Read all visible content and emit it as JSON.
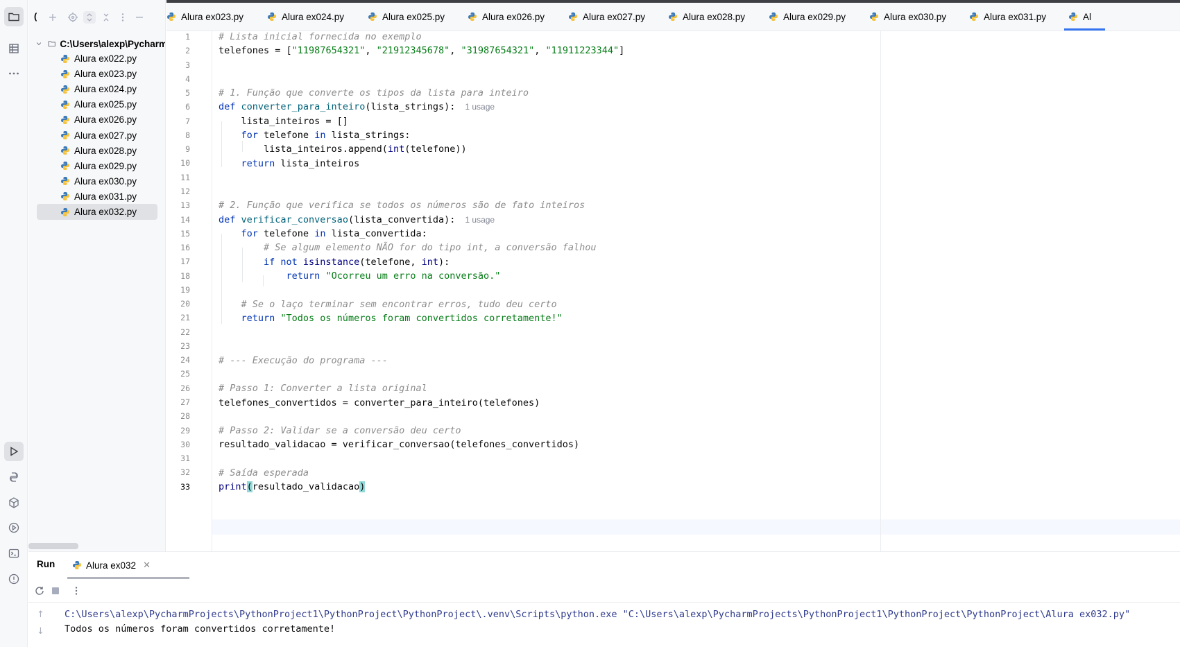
{
  "tabs": [
    {
      "label": "Alura ex023.py"
    },
    {
      "label": "Alura ex024.py"
    },
    {
      "label": "Alura ex025.py"
    },
    {
      "label": "Alura ex026.py"
    },
    {
      "label": "Alura ex027.py"
    },
    {
      "label": "Alura ex028.py"
    },
    {
      "label": "Alura ex029.py"
    },
    {
      "label": "Alura ex030.py"
    },
    {
      "label": "Alura ex031.py"
    },
    {
      "label": "Al"
    }
  ],
  "project": {
    "header_letter": "(",
    "root": "C:\\Users\\alexp\\Pycharm",
    "files": [
      "Alura ex022.py",
      "Alura ex023.py",
      "Alura ex024.py",
      "Alura ex025.py",
      "Alura ex026.py",
      "Alura ex027.py",
      "Alura ex028.py",
      "Alura ex029.py",
      "Alura ex030.py",
      "Alura ex031.py",
      "Alura ex032.py"
    ],
    "selected_file": "Alura ex032.py"
  },
  "editor": {
    "line_numbers": [
      "1",
      "2",
      "3",
      "4",
      "5",
      "6",
      "7",
      "8",
      "9",
      "10",
      "11",
      "12",
      "13",
      "14",
      "15",
      "16",
      "17",
      "18",
      "19",
      "20",
      "21",
      "22",
      "23",
      "24",
      "25",
      "26",
      "27",
      "28",
      "29",
      "30",
      "31",
      "32",
      "33"
    ],
    "current_line": "33",
    "code": {
      "l1": "# Lista inicial fornecida no exemplo",
      "l2_var": "telefones",
      "l2_op": " = [",
      "l2_s1": "\"11987654321\"",
      "l2_s2": "\"21912345678\"",
      "l2_s3": "\"31987654321\"",
      "l2_s4": "\"11911223344\"",
      "l2_end": "]",
      "l5": "# 1. Função que converte os tipos da lista para inteiro",
      "l6_kw": "def ",
      "l6_fn": "converter_para_inteiro",
      "l6_args": "(lista_strings):",
      "l6_hint": "1 usage",
      "l7": "    lista_inteiros = []",
      "l8_kw1": "    for ",
      "l8_mid": "telefone ",
      "l8_kw2": "in ",
      "l8_end": "lista_strings:",
      "l9_a": "        lista_inteiros.append(",
      "l9_bi": "int",
      "l9_b": "(telefone))",
      "l10_kw": "    return ",
      "l10_end": "lista_inteiros",
      "l13": "# 2. Função que verifica se todos os números são de fato inteiros",
      "l14_kw": "def ",
      "l14_fn": "verificar_conversao",
      "l14_args": "(lista_convertida):",
      "l14_hint": "1 usage",
      "l15_kw1": "    for ",
      "l15_mid": "telefone ",
      "l15_kw2": "in ",
      "l15_end": "lista_convertida:",
      "l16": "        # Se algum elemento NÃO for do tipo int, a conversão falhou",
      "l17_kw1": "        if not ",
      "l17_bi": "isinstance",
      "l17_mid": "(telefone, ",
      "l17_bi2": "int",
      "l17_end": "):",
      "l18_kw": "            return ",
      "l18_st": "\"Ocorreu um erro na conversão.\"",
      "l20": "    # Se o laço terminar sem encontrar erros, tudo deu certo",
      "l21_kw": "    return ",
      "l21_st": "\"Todos os números foram convertidos corretamente!\"",
      "l24": "# --- Execução do programa ---",
      "l26": "# Passo 1: Converter a lista original",
      "l27": "telefones_convertidos = converter_para_inteiro(telefones)",
      "l29": "# Passo 2: Validar se a conversão deu certo",
      "l30": "resultado_validacao = verificar_conversao(telefones_convertidos)",
      "l32": "# Saída esperada",
      "l33_bi": "print",
      "l33_open": "(",
      "l33_mid": "resultado_validacao",
      "l33_close": ")"
    }
  },
  "run": {
    "title": "Run",
    "config": "Alura ex032",
    "command": "C:\\Users\\alexp\\PycharmProjects\\PythonProject1\\PythonProject\\PythonProject\\.venv\\Scripts\\python.exe \"C:\\Users\\alexp\\PycharmProjects\\PythonProject1\\PythonProject\\PythonProject\\Alura ex032.py\"",
    "output": "Todos os números foram convertidos corretamente!"
  },
  "colors": {
    "keyword": "#0033b3",
    "string": "#067d17",
    "comment": "#8c8c8c",
    "function": "#00627a",
    "accent": "#3574f0"
  }
}
